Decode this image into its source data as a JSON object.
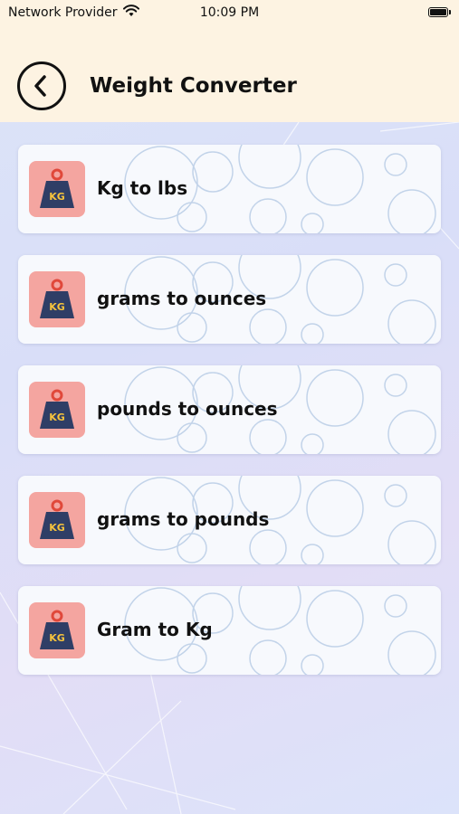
{
  "status": {
    "carrier": "Network Provider",
    "time": "10:09 PM",
    "wifi_icon": "wifi-icon",
    "battery_icon": "battery-icon"
  },
  "header": {
    "title": "Weight Converter",
    "back_icon": "back-arrow-icon"
  },
  "colors": {
    "header_bg": "#fdf3e2",
    "tile_bg": "#f4a5a0",
    "weight_icon": "#2f3e66",
    "weight_label": "#f6c33c"
  },
  "items": [
    {
      "label": "Kg to lbs",
      "icon_text": "KG"
    },
    {
      "label": "grams to ounces",
      "icon_text": "KG"
    },
    {
      "label": "pounds to ounces",
      "icon_text": "KG"
    },
    {
      "label": "grams to pounds",
      "icon_text": "KG"
    },
    {
      "label": "Gram to Kg",
      "icon_text": "KG"
    }
  ]
}
